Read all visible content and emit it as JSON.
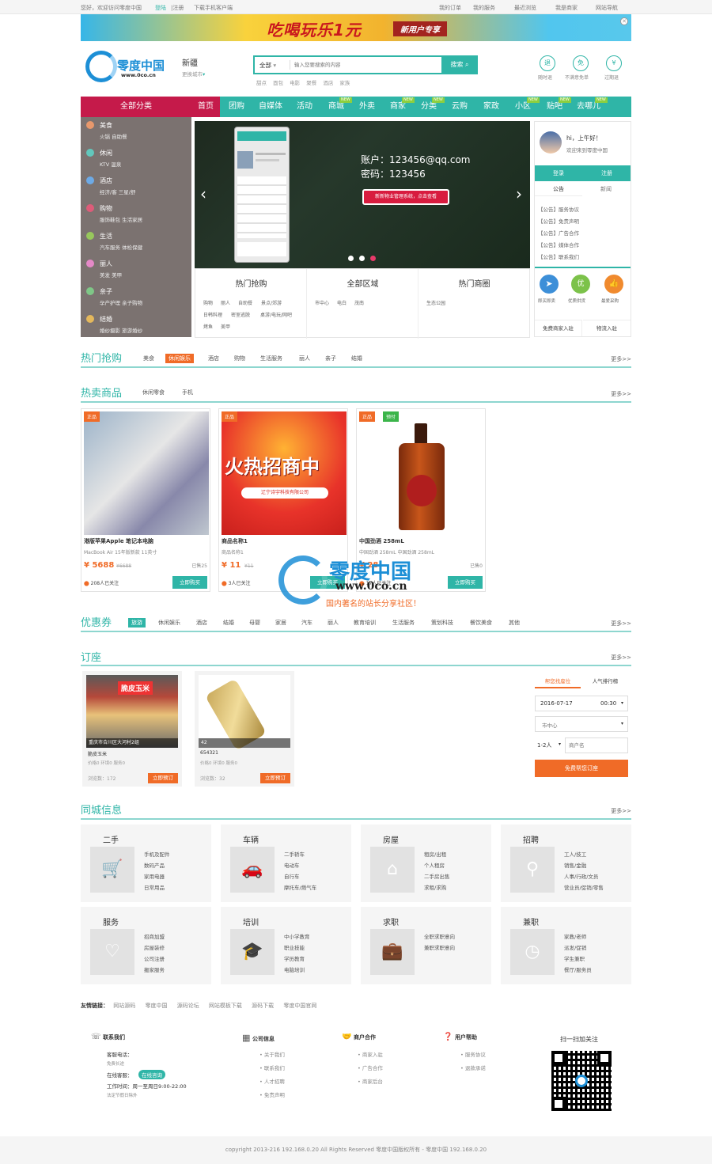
{
  "topbar": {
    "left": "您好，欢迎访问零度中国",
    "login": "登陆",
    "register": "|注册",
    "app": "下载手机客户端",
    "orders": "我的订单",
    "service": "我的服务",
    "recent": "最近浏览",
    "merchant": "我是商家",
    "sitenav": "网站导航"
  },
  "banner": {
    "text": "吃喝玩乐1元",
    "tag": "新用户专享"
  },
  "header": {
    "logo": "零度中国",
    "logo_sub": "www.0co.cn",
    "city": "新疆",
    "city_switch": "更换城市",
    "search_cat": "全部",
    "search_placeholder": "输入您要搜索的内容",
    "search_btn": "搜索",
    "hot": [
      "甜点",
      "面包",
      "电影",
      "聚餐",
      "酒店",
      "家族"
    ],
    "promises": [
      {
        "icon": "退",
        "label": "随时退"
      },
      {
        "icon": "免",
        "label": "不满意免单"
      },
      {
        "icon": "¥",
        "label": "过期退"
      }
    ]
  },
  "nav": {
    "all": "全部分类",
    "items": [
      "首页",
      "团购",
      "自媒体",
      "活动",
      "商城",
      "外卖",
      "商家",
      "分类",
      "云购",
      "家政",
      "小区",
      "贴吧",
      "去哪儿"
    ],
    "new_label": "NEW"
  },
  "categories": [
    {
      "title": "美食",
      "sub": "火锅  自助餐"
    },
    {
      "title": "休闲",
      "sub": "KTV  温泉"
    },
    {
      "title": "酒店",
      "sub": "经济/客  三星/舒"
    },
    {
      "title": "购物",
      "sub": "服饰鞋包  生活家居"
    },
    {
      "title": "生活",
      "sub": "汽车服务  体检保健"
    },
    {
      "title": "丽人",
      "sub": "美发  美甲"
    },
    {
      "title": "亲子",
      "sub": "孕产护理  亲子购物"
    },
    {
      "title": "结婚",
      "sub": "婚纱摄影  旅游婚纱"
    }
  ],
  "slider": {
    "account": "账户：123456@qq.com",
    "password": "密码：123456",
    "btn": "新新物业管理系统，点击查看"
  },
  "quick": {
    "c1": "热门抢购",
    "c2": "全部区域",
    "c3": "热门商圈",
    "c1_links": [
      "购物",
      "丽人",
      "自助餐",
      "景点/郊游",
      "日韩料理",
      "密室逃脱",
      "桌游/电玩/网吧",
      "烤鱼",
      "美甲"
    ],
    "c2_links": [
      "市中心",
      "电白",
      "茂南"
    ],
    "c3_links": [
      "生态公园"
    ]
  },
  "userbox": {
    "greeting": "hi，上午好！",
    "welcome": "欢迎来到零度中国",
    "login": "登录",
    "register": "注册",
    "tab1": "公告",
    "tab2": "新闻",
    "notices": [
      "【公告】服务协议",
      "【公告】免责声明",
      "【公告】广告合作",
      "【公告】媒体合作",
      "【公告】联系我们"
    ],
    "icons": [
      {
        "label": "即买即卖"
      },
      {
        "label": "优质供货"
      },
      {
        "label": "最爱采购"
      }
    ],
    "b1": "免费商家入驻",
    "b2": "物流入驻"
  },
  "hot_buy": {
    "title": "热门抢购",
    "tabs": [
      "美食",
      "休闲娱乐",
      "酒店",
      "购物",
      "生活服务",
      "丽人",
      "亲子",
      "结婚"
    ],
    "more": "更多>>"
  },
  "hot_goods": {
    "title": "热卖商品",
    "tabs": [
      "休闲零食",
      "手机"
    ],
    "more": "更多>>",
    "items": [
      {
        "badges": [
          "正品"
        ],
        "name": "港版苹果Apple 笔记本电脑",
        "desc": "MacBook Air 15年版新款 11英寸",
        "price": "¥ 5688",
        "old": "¥6688",
        "sold": "已售25",
        "follow": "208人已关注",
        "btn": "立即购买"
      },
      {
        "badges": [
          "正品"
        ],
        "name": "商品名称1",
        "desc": "商品名称1",
        "price": "¥ 11",
        "old": "¥11",
        "sold": "",
        "follow": "3人已关注",
        "btn": "立即购买"
      },
      {
        "badges": [
          "正品",
          "预付"
        ],
        "name": "中国劲酒 258mL",
        "desc": "中国劲酒 258mL 中国劲酒 258mL",
        "price": "¥ 28",
        "old": "",
        "sold": "已售0",
        "follow": "17人已关注",
        "btn": "立即购买"
      }
    ],
    "poster_text": "火热招商中",
    "poster_sub": "辽宁诗宇科技有限公司"
  },
  "watermark": {
    "name": "零度中国",
    "url": "www.0co.cn",
    "slogan": "国内著名的站长分享社区！"
  },
  "coupon": {
    "title": "优惠券",
    "tabs": [
      "旅游",
      "休闲娱乐",
      "酒店",
      "结婚",
      "母婴",
      "家居",
      "汽车",
      "丽人",
      "教育培训",
      "生活服务",
      "策划科技",
      "餐饮美食",
      "其他"
    ],
    "more": "更多>>"
  },
  "booking": {
    "title": "订座",
    "more": "更多>>",
    "items": [
      {
        "cap": "重庆市合川区大河村2组",
        "shop": "脆皮玉米",
        "name": "脆皮玉米",
        "meta": "价格0  环境0  服务0",
        "views": "浏览数：172",
        "btn": "立即预订"
      },
      {
        "cap": "42",
        "name": "654321",
        "meta": "价格0  环境0  服务0",
        "views": "浏览数：32",
        "btn": "立即预订"
      }
    ],
    "form": {
      "tab1": "帮您找座位",
      "tab2": "人气排行榜",
      "date": "2016-07-17",
      "time": "00:30",
      "area": "市中心",
      "people": "1-2人",
      "shop_ph": "商户名",
      "btn": "免费帮您订座"
    }
  },
  "city_info": {
    "title": "同城信息",
    "more": "更多>>",
    "blocks": [
      {
        "h": "二手",
        "icon": "🛒",
        "links": [
          "手机及配件",
          "数码产品",
          "家用电器",
          "日常用品"
        ]
      },
      {
        "h": "车辆",
        "icon": "🚗",
        "links": [
          "二手轿车",
          "电动车",
          "自行车",
          "摩托车/燃气车"
        ]
      },
      {
        "h": "房屋",
        "icon": "⌂",
        "links": [
          "租房/出租",
          "个人租房",
          "二手房出售",
          "求租/求购"
        ]
      },
      {
        "h": "招聘",
        "icon": "⚲",
        "links": [
          "工人/技工",
          "销售/金融",
          "人事/行政/文员",
          "营业员/促销/零售"
        ]
      },
      {
        "h": "服务",
        "icon": "♡",
        "links": [
          "招商加盟",
          "房屋装修",
          "公司注册",
          "搬家服务"
        ]
      },
      {
        "h": "培训",
        "icon": "🎓",
        "links": [
          "中小学教育",
          "职业技能",
          "学历教育",
          "电脑培训"
        ]
      },
      {
        "h": "求职",
        "icon": "💼",
        "links": [
          "全职求职意向",
          "兼职求职意向"
        ]
      },
      {
        "h": "兼职",
        "icon": "◷",
        "links": [
          "家教/老师",
          "派发/促销",
          "学生兼职",
          "餐厅/服务员"
        ]
      }
    ]
  },
  "friends": {
    "label": "友情链接：",
    "links": [
      "网站源码",
      "零度中国",
      "源码论坛",
      "网站模板下载",
      "源码下载",
      "零度中国官网"
    ]
  },
  "footer": {
    "contact_h": "联系我们",
    "phone_label": "客服电话：",
    "phone_val": "免费长途",
    "online_label": "在线客服：",
    "online_btn": "在线咨询",
    "hours": "工作时间：周一至周日9:00-22:00",
    "holiday": "法定节假日除外",
    "company_h": "公司信息",
    "company": [
      "关于我们",
      "联系我们",
      "人才招聘",
      "免责声明"
    ],
    "biz_h": "商户合作",
    "biz": [
      "商家入驻",
      "广告合作",
      "商家后台"
    ],
    "help_h": "用户帮助",
    "help": [
      "服务协议",
      "退款承诺"
    ],
    "qr_h": "扫一扫加关注"
  },
  "copyright": "copyright 2013-216 192.168.0.20 All Rights Reserved 零度中国版权所有 - 零度中国 192.168.0.20"
}
